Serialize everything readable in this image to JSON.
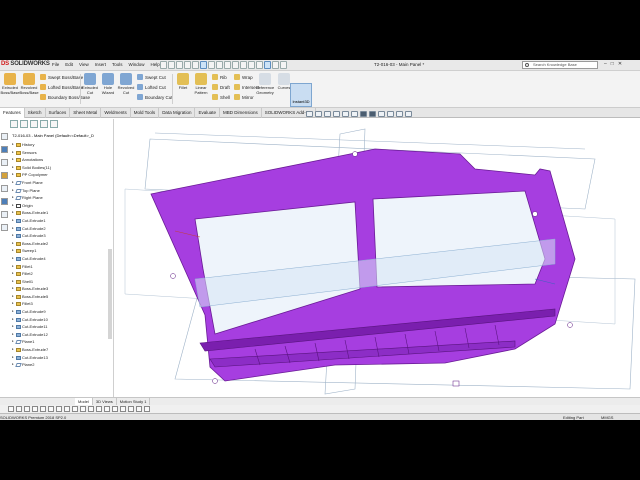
{
  "app": {
    "logo_ds": "DS",
    "logo_name": "SOLIDWORKS",
    "doc_title": "T2-016-03 - Main Panel *",
    "search_placeholder": "Search Knowledge Base"
  },
  "menus": [
    "File",
    "Edit",
    "View",
    "Insert",
    "Tools",
    "Window",
    "Help"
  ],
  "ribbon": {
    "big_buttons": [
      {
        "label": "Extruded Boss/Base",
        "color": "#e8b34a"
      },
      {
        "label": "Revolved Boss/Base",
        "color": "#e8b34a"
      },
      {
        "label": "Extruded Cut",
        "color": "#7fa6d3"
      },
      {
        "label": "Hole Wizard",
        "color": "#7fa6d3"
      },
      {
        "label": "Revolved Cut",
        "color": "#7fa6d3"
      }
    ],
    "col1": [
      "Swept Boss/Base",
      "Lofted Boss/Base",
      "Boundary Boss/Base"
    ],
    "col2": [
      "Swept Cut",
      "Lofted Cut",
      "Boundary Cut"
    ],
    "col3": [
      "Fillet",
      "Linear Pattern"
    ],
    "col4": [
      "Rib",
      "Draft",
      "Shell"
    ],
    "col5": [
      "Wrap",
      "Intersect",
      "Mirror"
    ],
    "col6": [
      "Reference Geometry",
      "Curves"
    ],
    "instant3d": "Instant3D"
  },
  "command_tabs": [
    "Features",
    "Sketch",
    "Surfaces",
    "Sheet Metal",
    "Weldments",
    "Mold Tools",
    "Data Migration",
    "Evaluate",
    "MBD Dimensions",
    "SOLIDWORKS Add-Ins"
  ],
  "tree": {
    "root": "T2-016-03 - Main Panel (Default<<Default>_D",
    "items": [
      {
        "label": "History",
        "type": "folder"
      },
      {
        "label": "Sensors",
        "type": "folder"
      },
      {
        "label": "Annotations",
        "type": "folder"
      },
      {
        "label": "Solid Bodies(11)",
        "type": "folder"
      },
      {
        "label": "PP Copolymer",
        "type": "folder"
      },
      {
        "label": "Front Plane",
        "type": "plane"
      },
      {
        "label": "Top Plane",
        "type": "plane"
      },
      {
        "label": "Right Plane",
        "type": "plane"
      },
      {
        "label": "Origin",
        "type": "sk"
      },
      {
        "label": "Boss-Extrude1",
        "type": "feat"
      },
      {
        "label": "Cut-Extrude1",
        "type": "cut"
      },
      {
        "label": "Cut-Extrude2",
        "type": "cut"
      },
      {
        "label": "Cut-Extrude3",
        "type": "cut"
      },
      {
        "label": "Boss-Extrude2",
        "type": "feat"
      },
      {
        "label": "Sweep1",
        "type": "feat"
      },
      {
        "label": "Cut-Extrude4",
        "type": "cut"
      },
      {
        "label": "Fillet1",
        "type": "feat"
      },
      {
        "label": "Fillet2",
        "type": "feat"
      },
      {
        "label": "Shell1",
        "type": "feat"
      },
      {
        "label": "Boss-Extrude3",
        "type": "feat"
      },
      {
        "label": "Boss-Extrude5",
        "type": "feat"
      },
      {
        "label": "Fillet3",
        "type": "feat"
      },
      {
        "label": "Cut-Extrude9",
        "type": "cut"
      },
      {
        "label": "Cut-Extrude10",
        "type": "cut"
      },
      {
        "label": "Cut-Extrude11",
        "type": "cut"
      },
      {
        "label": "Cut-Extrude12",
        "type": "cut"
      },
      {
        "label": "Plane1",
        "type": "plane"
      },
      {
        "label": "Boss-Extrude7",
        "type": "feat"
      },
      {
        "label": "Cut-Extrude13",
        "type": "cut"
      },
      {
        "label": "Plane2",
        "type": "plane"
      }
    ]
  },
  "bottom_tabs": [
    "Model",
    "3D Views",
    "Motion Study 1"
  ],
  "status": {
    "left": "SOLIDWORKS Premium 2018 SP2.0",
    "editing": "Editing Part",
    "units": "MMGS"
  },
  "colors": {
    "part": "#a63ee0",
    "part_dark": "#7a1fae",
    "glass": "#eef4fb"
  }
}
